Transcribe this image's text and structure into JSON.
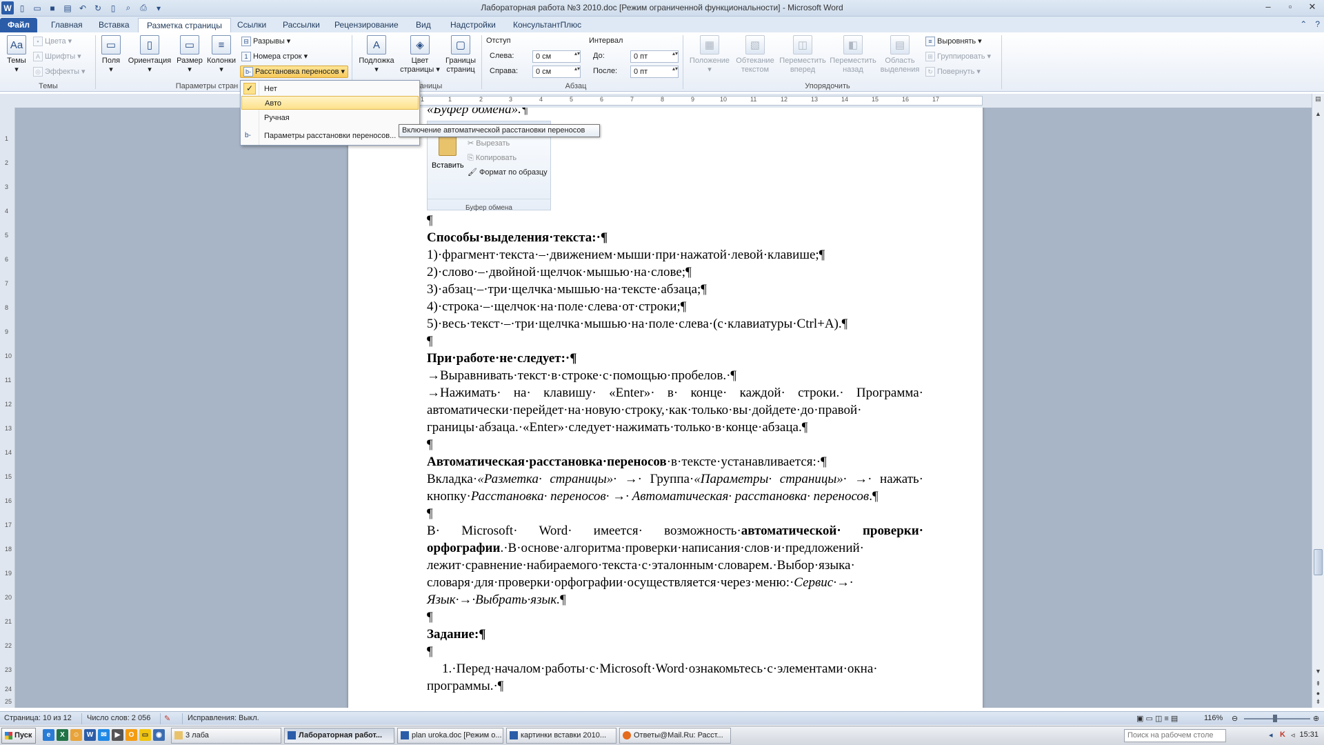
{
  "window": {
    "title": "Лабораторная работа №3 2010.doc [Режим ограниченной функциональности] - Microsoft Word"
  },
  "tabs": {
    "file": "Файл",
    "home": "Главная",
    "insert": "Вставка",
    "layout": "Разметка страницы",
    "refs": "Ссылки",
    "mailings": "Рассылки",
    "review": "Рецензирование",
    "view": "Вид",
    "addins": "Надстройки",
    "consultant": "КонсультантПлюс"
  },
  "ribbon": {
    "themes": {
      "themes": "Темы",
      "colors": "Цвета",
      "fonts": "Шрифты",
      "effects": "Эффекты",
      "group": "Темы"
    },
    "page_setup": {
      "margins": "Поля",
      "orientation": "Ориентация",
      "size": "Размер",
      "columns": "Колонки",
      "breaks": "Разрывы",
      "line_numbers": "Номера строк",
      "hyphenation": "Расстановка переносов",
      "group": "Параметры стран"
    },
    "background": {
      "watermark": "Подложка",
      "page_color": "Цвет страницы",
      "page_borders": "Границы страниц",
      "group": "аницы"
    },
    "paragraph": {
      "indent": "Отступ",
      "left_label": "Слева:",
      "left_value": "0 см",
      "right_label": "Справа:",
      "right_value": "0 см",
      "spacing": "Интервал",
      "before_label": "До:",
      "before_value": "0 пт",
      "after_label": "После:",
      "after_value": "0 пт",
      "group": "Абзац"
    },
    "arrange": {
      "position": "Положение",
      "wrap": "Обтекание текстом",
      "bring_forward": "Переместить вперед",
      "send_backward": "Переместить назад",
      "selection_pane": "Область выделения",
      "align": "Выровнять",
      "group_btn": "Группировать",
      "rotate": "Повернуть",
      "group": "Упорядочить"
    }
  },
  "dropdown": {
    "items": [
      "Нет",
      "Авто",
      "Ручная",
      "Параметры расстановки переносов..."
    ]
  },
  "tooltip": "Включение автоматической расстановки переносов",
  "ruler": {
    "h_ticks": [
      "1",
      "2",
      "1",
      "1",
      "2",
      "3",
      "4",
      "5",
      "6",
      "7",
      "8",
      "9",
      "10",
      "11",
      "12",
      "13",
      "14",
      "15",
      "16",
      "17"
    ],
    "v_ticks": [
      "1",
      "2",
      "3",
      "4",
      "5",
      "6",
      "7",
      "8",
      "9",
      "10",
      "11",
      "12",
      "13",
      "14",
      "15",
      "16",
      "17",
      "18",
      "19",
      "20",
      "21",
      "22",
      "23",
      "24",
      "25"
    ]
  },
  "document": {
    "heading_clip": "«Буфер обмена».¶",
    "clip": {
      "paste": "Вставить",
      "cut": "Вырезать",
      "copy": "Копировать",
      "format": "Формат по образцу",
      "footer": "Буфер обмена"
    },
    "pilcrow": "¶",
    "sel_title": "Способы·выделения·текста:·¶",
    "sel_items": [
      "1)·фрагмент·текста·–·движением·мыши·при·нажатой·левой·клавише;¶",
      "2)·слово·–·двойной·щелчок·мышью·на·слове;¶",
      "3)·абзац·–·три·щелчка·мышью·на·тексте·абзаца;¶",
      "4)·строка·–·щелчок·на·поле·слева·от·строки;¶",
      "5)·весь·текст·–·три·щелчка·мышью·на·поле·слева·(с·клавиатуры·Ctrl+A).¶"
    ],
    "dont_title": "При·работе·не·следует:·¶",
    "dont_1": "→Выравнивать·текст·в·строке·с·помощью·пробелов.·¶",
    "dont_2": "→Нажимать· на· клавишу· «Enter»· в· конце· каждой· строки.· Программа· автоматически·перейдет·на·новую·строку,·как·только·вы·дойдете·до·правой· границы·абзаца.·«Enter»·следует·нажимать·только·в·конце·абзаца.¶",
    "auto_bold": "Автоматическая·расстановка·переносов",
    "auto_rest": "·в·тексте·устанавливается:·¶",
    "path_1": "Вкладка·",
    "path_2": "«Разметка· страницы»· →",
    "path_3": "· Группа·",
    "path_4": "«Параметры· страницы»· →",
    "path_5": "· нажать· кнопку·",
    "path_6": "Расстановка· переносов· →· Автоматическая· расстановка· переносов",
    "path_7": ".¶",
    "spell_1": "В· Microsoft· Word· имеется· возможность·",
    "spell_2": "автоматической· проверки· орфографии",
    "spell_3": ".·В·основе·алгоритма·проверки·написания·слов·и·предложений· лежит·сравнение·набираемого·текста·с·эталонным·словарем.·Выбор·языка· словаря·для·проверки·орфографии·осуществляется·через·меню:·",
    "spell_4": "Сервис·→· Язык·→·Выбрать·язык.",
    "spell_5": "¶",
    "task_title": "Задание:¶",
    "task_1": "1.·Перед·началом·работы·с·Microsoft·Word·ознакомьтесь·с·элементами·окна· программы.·¶"
  },
  "status": {
    "page": "Страница: 10 из 12",
    "words": "Число слов: 2 056",
    "track": "Исправления: Выкл.",
    "zoom": "116%"
  },
  "taskbar": {
    "start": "Пуск",
    "tasks": [
      "3 лаба",
      "Лабораторная работ...",
      "plan uroka.doc [Режим о...",
      "картинки вставки 2010...",
      "Ответы@Mail.Ru: Расст..."
    ],
    "search_placeholder": "Поиск на рабочем столе",
    "time": "15:31"
  }
}
